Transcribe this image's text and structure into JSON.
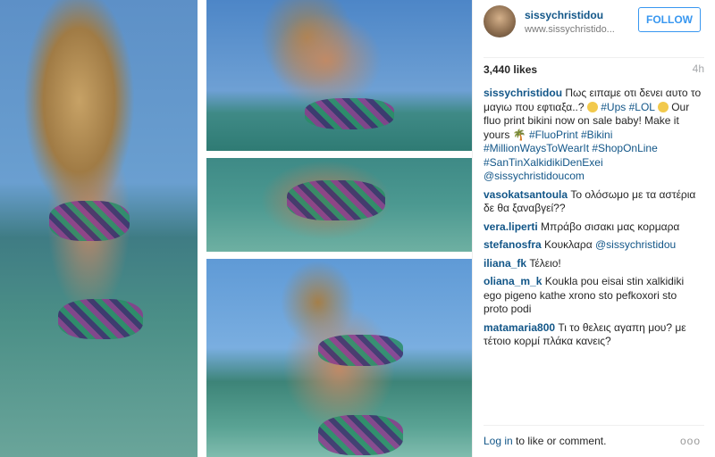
{
  "post": {
    "username": "sissychristidou",
    "site": "www.sissychristido...",
    "follow_label": "FOLLOW",
    "likes": "3,440 likes",
    "time": "4h"
  },
  "caption": {
    "username": "sissychristidou",
    "text1": "Πως ειπαμε οτι δενει αυτο το μαγιω που εφτιαξα..?",
    "tag_ups": "#Ups",
    "tag_lol": "#LOL",
    "text2": "Our fluo print bikini now on sale baby! Make it yours",
    "tags": "#FluoPrint #Bikini #MillionWaysToWearIt #ShopOnLine #SanTinXalkidikiDenExei",
    "mention": "@sissychristidoucom"
  },
  "comments": [
    {
      "user": "vasokatsantoula",
      "text": "Το ολόσωμο με τα αστέρια δε θα ξαναβγεί??"
    },
    {
      "user": "vera.liperti",
      "text": "Μπράβο σισακι μας κορμαρα"
    },
    {
      "user": "stefanosfra",
      "text": "Κουκλαρα",
      "mention": "@sissychristidou"
    },
    {
      "user": "iliana_fk",
      "text": "Τέλειο!"
    },
    {
      "user": "oliana_m_k",
      "text": "Koukla pou eisai stin xalkidiki ego pigeno kathe xrono sto pefkoxori sto proto podi"
    },
    {
      "user": "matamaria800",
      "text": "Τι το θελεις αγαπη μου? με τέτοιο κορμί πλάκα κανεις?"
    }
  ],
  "footer": {
    "login_link": "Log in",
    "login_rest": " to like or comment.",
    "more": "ooo"
  },
  "colors": {
    "accent": "#3897f0",
    "link": "#125688"
  }
}
